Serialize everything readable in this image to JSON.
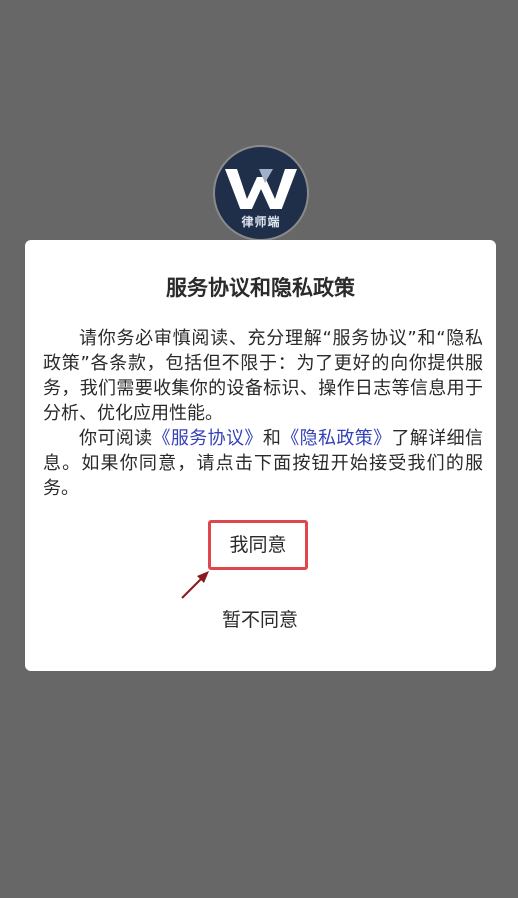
{
  "app": {
    "logo_text": "律师端",
    "logo_icon": "w-logo-icon"
  },
  "dialog": {
    "title": "服务协议和隐私政策",
    "para1": "请你务必审慎阅读、充分理解“服务协议”和“隐私政策”各条款，包括但不限于：为了更好的向你提供服务，我们需要收集你的设备标识、操作日志等信息用于分析、优化应用性能。",
    "para2_prefix": "你可阅读",
    "service_link": "《服务协议》",
    "para2_and": "和",
    "privacy_link": "《隐私政策》",
    "para2_suffix": "了解详细信息。如果你同意，请点击下面按钮开始接受我们的服务。",
    "agree_label": "我同意",
    "disagree_label": "暂不同意"
  },
  "colors": {
    "overlay": "#676767",
    "link": "#3340b8",
    "highlight": "#e0474c",
    "logo_bg": "#1f2f4a"
  }
}
